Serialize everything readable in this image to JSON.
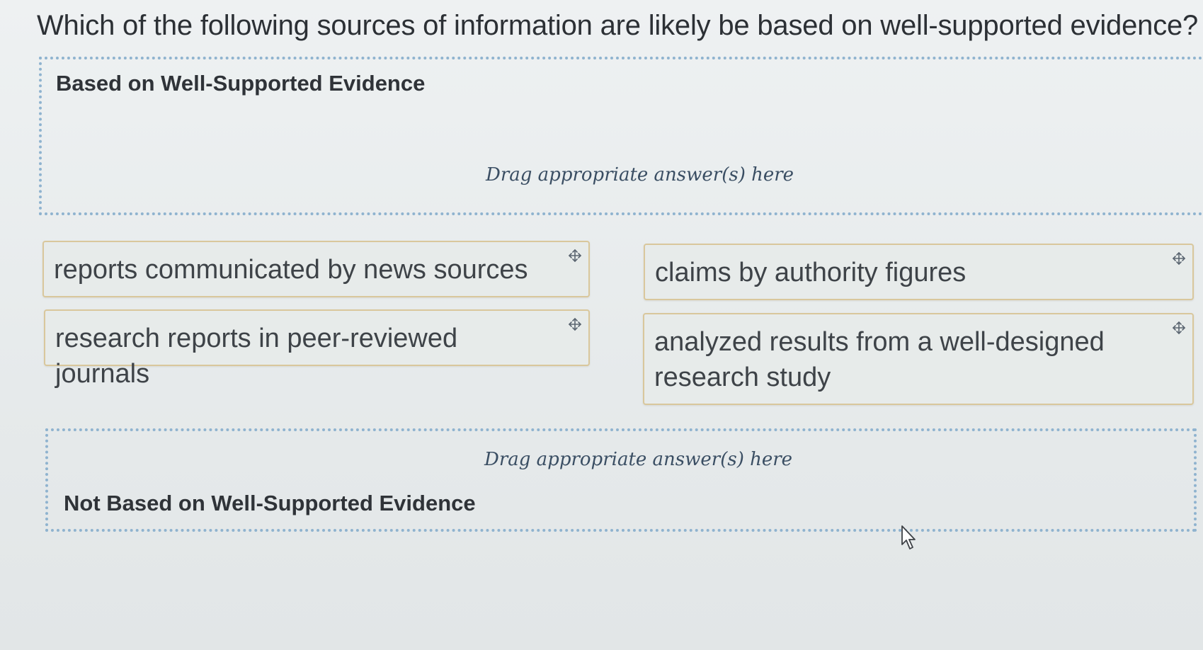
{
  "question": "Which of the following sources of information are likely be based on well-supported evidence?",
  "zones": [
    {
      "title": "Based on Well-Supported Evidence",
      "hint": "Drag appropriate answer(s) here"
    },
    {
      "title": "Not Based on Well-Supported Evidence",
      "hint": "Drag appropriate answer(s) here"
    }
  ],
  "answers": [
    {
      "label": "reports communicated by news sources",
      "icon": "move-icon"
    },
    {
      "label": "claims by authority figures",
      "icon": "move-icon"
    },
    {
      "label": "research reports in peer-reviewed journals",
      "icon": "move-icon"
    },
    {
      "label": "analyzed results from a well-designed research study",
      "icon": "move-icon"
    }
  ],
  "colors": {
    "zone_border": "#8fb3cf",
    "card_border": "#d9c79c",
    "hint_text": "#3a4e63"
  }
}
